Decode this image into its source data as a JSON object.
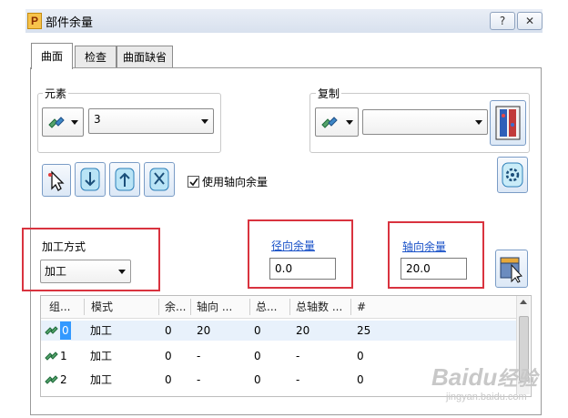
{
  "window": {
    "title": "部件余量",
    "help_label": "?",
    "close_label": "✕"
  },
  "tabs": [
    {
      "label": "曲面",
      "active": true
    },
    {
      "label": "检查",
      "active": false
    },
    {
      "label": "曲面缺省",
      "active": false
    }
  ],
  "element_group": {
    "label": "元素",
    "combo_value": "3"
  },
  "copy_group": {
    "label": "复制",
    "combo_value": ""
  },
  "toolbar": {
    "use_axial_label": "使用轴向余量",
    "use_axial_checked": true
  },
  "machining": {
    "label": "加工方式",
    "value": "加工"
  },
  "radial": {
    "label": "径向余量",
    "value": "0.0"
  },
  "axial": {
    "label": "轴向余量",
    "value": "20.0"
  },
  "table": {
    "headers": [
      "组...",
      "模式",
      "余...",
      "轴向 ...",
      "总...",
      "总轴数 ...",
      "#"
    ],
    "rows": [
      {
        "group": "0",
        "mode": "加工",
        "allow": "0",
        "axial": "20",
        "total": "0",
        "total_axial": "20",
        "count": "25",
        "selected": true
      },
      {
        "group": "1",
        "mode": "加工",
        "allow": "0",
        "axial": "-",
        "total": "0",
        "total_axial": "-",
        "count": "0",
        "selected": false
      },
      {
        "group": "2",
        "mode": "加工",
        "allow": "0",
        "axial": "-",
        "total": "0",
        "total_axial": "-",
        "count": "0",
        "selected": false
      }
    ]
  },
  "watermark": {
    "brand": "Baidu",
    "cn": "经验",
    "url": "jingyan.baidu.com"
  },
  "colors": {
    "highlight_red": "#d9333f",
    "link_blue": "#1a52c8",
    "selection_blue": "#3399ff"
  }
}
